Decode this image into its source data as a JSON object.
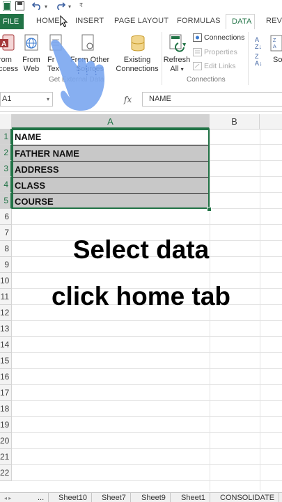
{
  "ribbon_tabs": {
    "file": "FILE",
    "home": "HOME",
    "insert": "INSERT",
    "page_layout": "PAGE LAYOUT",
    "formulas": "FORMULAS",
    "data": "DATA",
    "review": "REVI"
  },
  "ribbon": {
    "from_access_1": "rom",
    "from_access_2": "ccess",
    "from_web_1": "From",
    "from_web_2": "Web",
    "from_text_1": "Fr",
    "from_text_2": "Tex",
    "from_other_1": "From Other",
    "from_other_2": "Sources",
    "get_external_data": "Get External Data",
    "existing_1": "Existing",
    "existing_2": "Connections",
    "refresh_1": "Refresh",
    "refresh_2": "All",
    "connections": "Connections",
    "properties": "Properties",
    "edit_links": "Edit Links",
    "connections_group": "Connections",
    "sort": "So"
  },
  "formula_bar": {
    "name_box": "A1",
    "fx": "fx",
    "value": "NAME"
  },
  "columns": [
    "A",
    "B"
  ],
  "rows": [
    "1",
    "2",
    "3",
    "4",
    "5",
    "6",
    "7",
    "8",
    "9",
    "10",
    "11",
    "12",
    "13",
    "14",
    "15",
    "16",
    "17",
    "18",
    "19",
    "20",
    "21",
    "22"
  ],
  "cells": [
    "NAME",
    "FATHER NAME",
    "ADDRESS",
    "CLASS",
    "COURSE"
  ],
  "overlay": {
    "line1": "Select data",
    "line2": "click home tab"
  },
  "sheet_tabs": [
    "...",
    "Sheet10",
    "Sheet7",
    "Sheet9",
    "Sheet1",
    "CONSOLIDATE"
  ],
  "colors": {
    "accent": "#217346",
    "selection_fill": "#c8c8c8",
    "hand": "#7aa6f0"
  }
}
